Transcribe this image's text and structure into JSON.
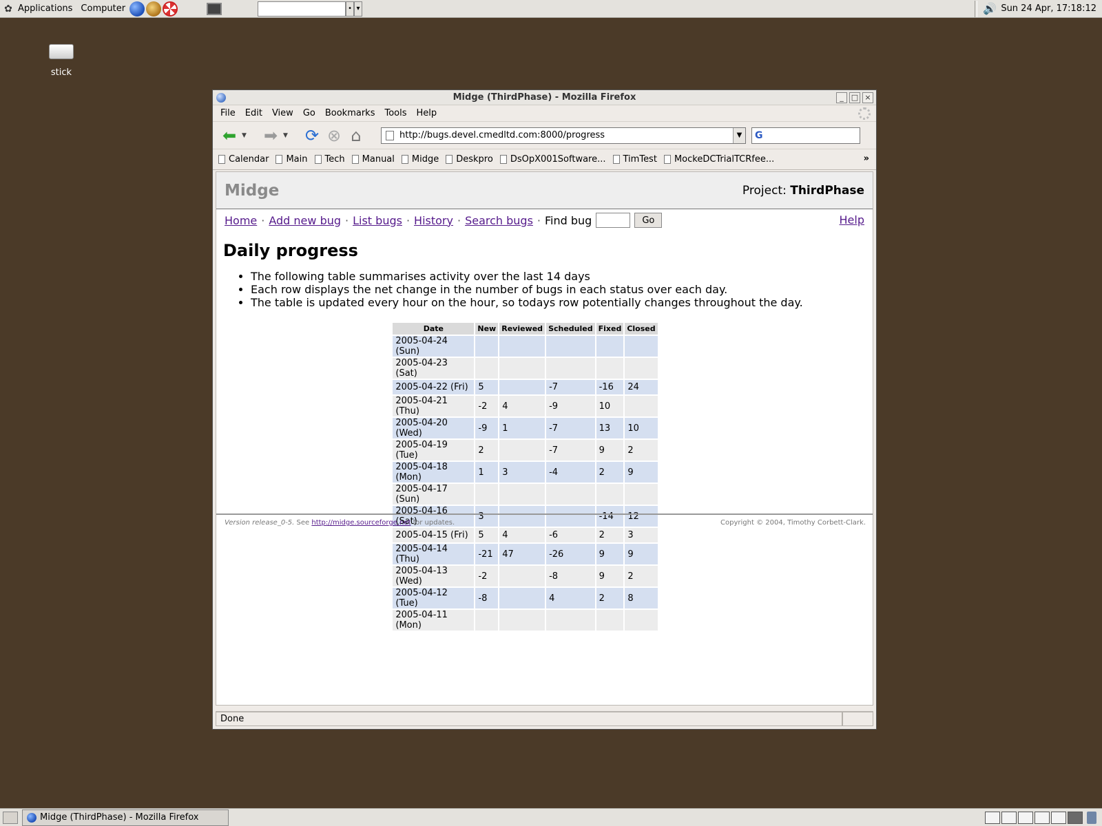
{
  "top_panel": {
    "applications": "Applications",
    "computer": "Computer",
    "clock": "Sun 24 Apr, 17:18:12"
  },
  "desktop": {
    "icon_label": "stick"
  },
  "window": {
    "title": "Midge (ThirdPhase) - Mozilla Firefox",
    "menu": [
      "File",
      "Edit",
      "View",
      "Go",
      "Bookmarks",
      "Tools",
      "Help"
    ],
    "url": "http://bugs.devel.cmedltd.com:8000/progress",
    "search_icon": "G",
    "bookmarks": [
      "Calendar",
      "Main",
      "Tech",
      "Manual",
      "Midge",
      "Deskpro",
      "DsOpX001Software...",
      "TimTest",
      "MockeDCTrialTCRfee..."
    ],
    "bookmarks_more": "»",
    "status": "Done"
  },
  "page": {
    "site_title": "Midge",
    "project_label": "Project:",
    "project_name": "ThirdPhase",
    "nav": {
      "home": "Home",
      "add_bug": "Add new bug",
      "list_bugs": "List bugs",
      "history": "History",
      "search_bugs": "Search bugs",
      "find_bug": "Find bug",
      "go": "Go",
      "help": "Help"
    },
    "heading": "Daily progress",
    "notes": [
      "The following table summarises activity over the last 14 days",
      "Each row displays the net change in the number of bugs in each status over each day.",
      "The table is updated every hour on the hour, so todays row potentially changes throughout the day."
    ],
    "table": {
      "headers": [
        "Date",
        "New",
        "Reviewed",
        "Scheduled",
        "Fixed",
        "Closed"
      ],
      "rows": [
        [
          "2005-04-24 (Sun)",
          "",
          "",
          "",
          "",
          ""
        ],
        [
          "2005-04-23 (Sat)",
          "",
          "",
          "",
          "",
          ""
        ],
        [
          "2005-04-22 (Fri)",
          "5",
          "",
          "-7",
          "-16",
          "24"
        ],
        [
          "2005-04-21 (Thu)",
          "-2",
          "4",
          "-9",
          "10",
          ""
        ],
        [
          "2005-04-20 (Wed)",
          "-9",
          "1",
          "-7",
          "13",
          "10"
        ],
        [
          "2005-04-19 (Tue)",
          "2",
          "",
          "-7",
          "9",
          "2"
        ],
        [
          "2005-04-18 (Mon)",
          "1",
          "3",
          "-4",
          "2",
          "9"
        ],
        [
          "2005-04-17 (Sun)",
          "",
          "",
          "",
          "",
          ""
        ],
        [
          "2005-04-16 (Sat)",
          "3",
          "",
          "",
          "-14",
          "12"
        ],
        [
          "2005-04-15 (Fri)",
          "5",
          "4",
          "-6",
          "2",
          "3"
        ],
        [
          "2005-04-14 (Thu)",
          "-21",
          "47",
          "-26",
          "9",
          "9"
        ],
        [
          "2005-04-13 (Wed)",
          "-2",
          "",
          "-8",
          "9",
          "2"
        ],
        [
          "2005-04-12 (Tue)",
          "-8",
          "",
          "4",
          "2",
          "8"
        ],
        [
          "2005-04-11 (Mon)",
          "",
          "",
          "",
          "",
          ""
        ]
      ]
    },
    "footer": {
      "version": "Version release_0-5.",
      "see": "See",
      "link": "http://midge.sourceforge.net",
      "for_updates": "for updates.",
      "copyright": "Copyright © 2004, Timothy Corbett-Clark."
    }
  },
  "taskbar": {
    "task_label": "Midge (ThirdPhase) - Mozilla Firefox"
  }
}
